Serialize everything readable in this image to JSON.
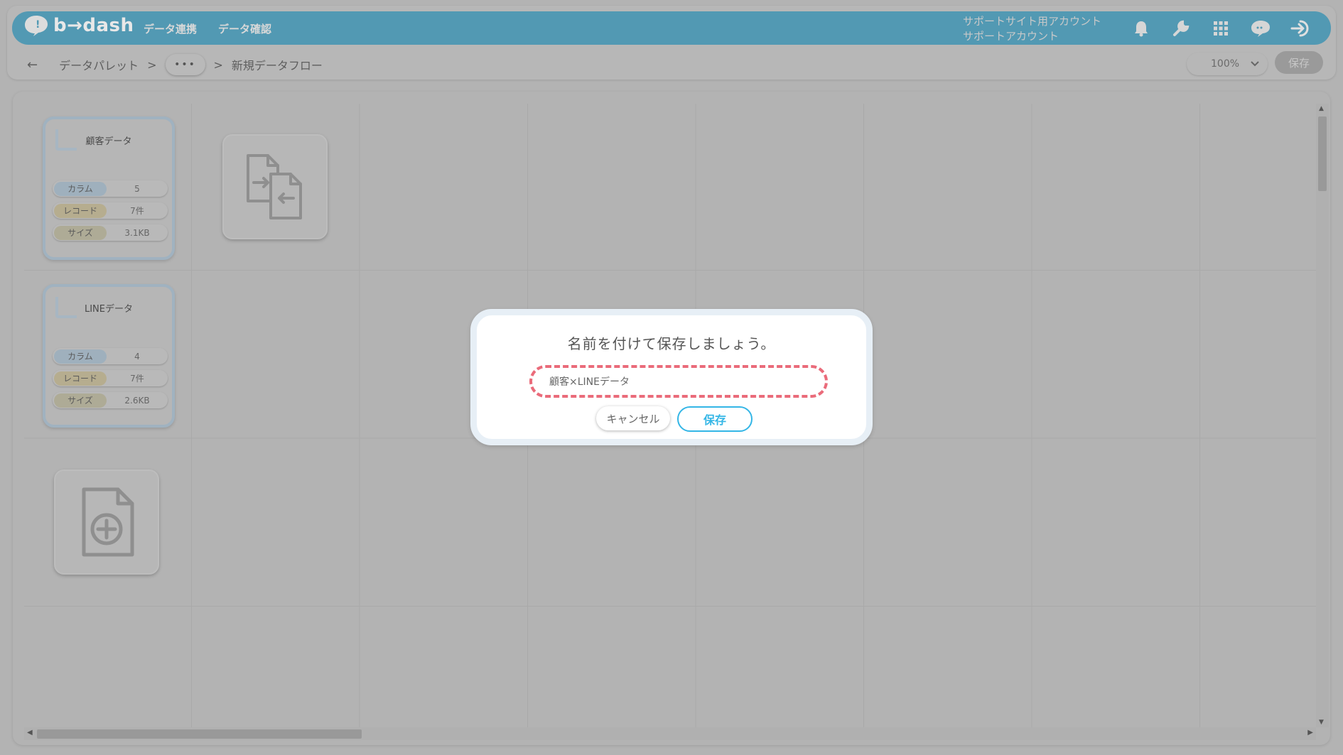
{
  "header": {
    "brand": "b→dash",
    "nav": [
      "データ連携",
      "データ確認"
    ],
    "account_line1": "サポートサイト用アカウント",
    "account_line2": "サポートアカウント",
    "icons": [
      "bell-icon",
      "wrench-icon",
      "grid-icon",
      "chat-icon",
      "logout-icon"
    ]
  },
  "breadcrumb": {
    "back": "←",
    "root": "データパレット",
    "sep": ">",
    "more": "•••",
    "current": "新規データフロー"
  },
  "toolbar": {
    "zoom": "100%",
    "save_label": "保存"
  },
  "cards": [
    {
      "title": "顧客データ",
      "rows": [
        {
          "key": "カラム",
          "value": "5"
        },
        {
          "key": "レコード",
          "value": "7件"
        },
        {
          "key": "サイズ",
          "value": "3.1KB"
        }
      ]
    },
    {
      "title": "LINEデータ",
      "rows": [
        {
          "key": "カラム",
          "value": "4"
        },
        {
          "key": "レコード",
          "value": "7件"
        },
        {
          "key": "サイズ",
          "value": "2.6KB"
        }
      ]
    }
  ],
  "modal": {
    "title": "名前を付けて保存しましょう。",
    "input_value": "顧客×LINEデータ",
    "cancel_label": "キャンセル",
    "save_label": "保存"
  },
  "colors": {
    "header": "#5299b3",
    "accent": "#34b6e6",
    "highlight": "#ea6b7a"
  }
}
